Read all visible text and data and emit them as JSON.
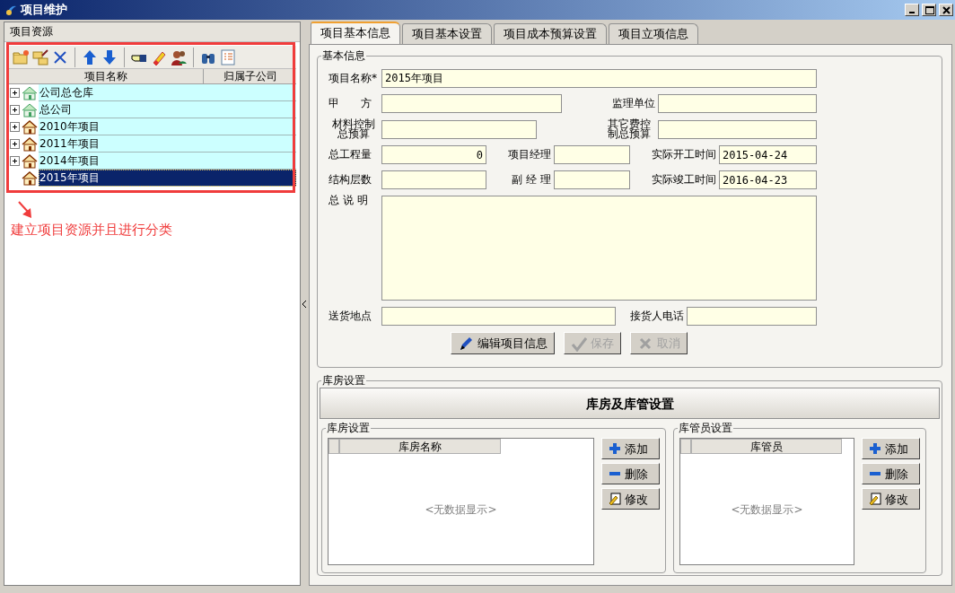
{
  "window": {
    "title": "项目维护"
  },
  "left_panel": {
    "title": "项目资源",
    "tree": {
      "columns": [
        "项目名称",
        "归属子公司"
      ],
      "items": [
        {
          "label": "公司总仓库",
          "kind": "company",
          "expandable": true,
          "selected": false
        },
        {
          "label": "总公司",
          "kind": "company",
          "expandable": true,
          "selected": false
        },
        {
          "label": "2010年项目",
          "kind": "project",
          "expandable": true,
          "selected": false
        },
        {
          "label": "2011年项目",
          "kind": "project",
          "expandable": true,
          "selected": false
        },
        {
          "label": "2014年项目",
          "kind": "project",
          "expandable": true,
          "selected": false
        },
        {
          "label": "2015年项目",
          "kind": "project",
          "expandable": false,
          "selected": true
        }
      ]
    },
    "annotation": "建立项目资源并且进行分类"
  },
  "tabs": [
    {
      "label": "项目基本信息",
      "selected": true
    },
    {
      "label": "项目基本设置",
      "selected": false
    },
    {
      "label": "项目成本预算设置",
      "selected": false
    },
    {
      "label": "项目立项信息",
      "selected": false
    }
  ],
  "basic_info": {
    "title": "基本信息",
    "rows": [
      [
        {
          "label": "项目名称*",
          "value": "2015年项目"
        }
      ],
      [
        {
          "label": "甲　　方"
        },
        {
          "label": "监理单位"
        }
      ],
      [
        {
          "label": "材料控制总预算"
        },
        {
          "label": "其它费控制总预算"
        }
      ],
      [
        {
          "label": "总工程量",
          "value": "0"
        },
        {
          "label": "项目经理"
        },
        {
          "label": "实际开工时间",
          "value": "2015-04-24"
        }
      ],
      [
        {
          "label": "结构层数"
        },
        {
          "label": "副 经 理"
        },
        {
          "label": "实际竣工时间",
          "value": "2016-04-23"
        }
      ],
      [
        {
          "label": "总 说 明",
          "kind": "textarea"
        }
      ],
      [
        {
          "label": "送货地点"
        },
        {
          "label": "接货人电话"
        }
      ]
    ],
    "buttons": [
      {
        "label": "编辑项目信息",
        "kind": "edit",
        "disabled": false
      },
      {
        "label": "保存",
        "kind": "save",
        "disabled": true
      },
      {
        "label": "取消",
        "kind": "cancel",
        "disabled": true
      }
    ]
  },
  "warehouse": {
    "title": "库房设置",
    "header": "库房及库管设置",
    "groups": [
      {
        "title": "库房设置",
        "column": "库房名称",
        "empty_text": "<无数据显示>",
        "buttons": [
          {
            "label": "添加",
            "kind": "add"
          },
          {
            "label": "删除",
            "kind": "remove"
          },
          {
            "label": "修改",
            "kind": "modify"
          }
        ]
      },
      {
        "title": "库管员设置",
        "column": "库管员",
        "empty_text": "<无数据显示>",
        "buttons": [
          {
            "label": "添加",
            "kind": "add"
          },
          {
            "label": "删除",
            "kind": "remove"
          },
          {
            "label": "修改",
            "kind": "modify"
          }
        ]
      }
    ]
  }
}
